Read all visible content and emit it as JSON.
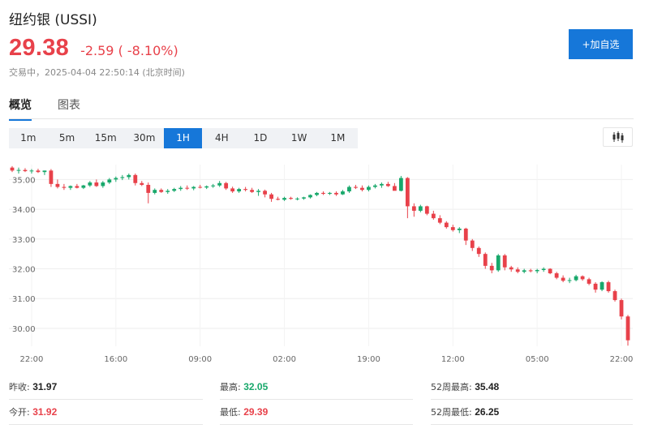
{
  "header": {
    "title": "纽约银 (USSI)",
    "price": "29.38",
    "change": "-2.59 ( -8.10%)",
    "status": "交易中，2025-04-04 22:50:14 (北京时间)",
    "add_button": "+加自选"
  },
  "tabs": [
    {
      "label": "概览",
      "active": true
    },
    {
      "label": "图表",
      "active": false
    }
  ],
  "intervals": [
    {
      "label": "1m",
      "active": false
    },
    {
      "label": "5m",
      "active": false
    },
    {
      "label": "15m",
      "active": false
    },
    {
      "label": "30m",
      "active": false
    },
    {
      "label": "1H",
      "active": true
    },
    {
      "label": "4H",
      "active": false
    },
    {
      "label": "1D",
      "active": false
    },
    {
      "label": "1W",
      "active": false
    },
    {
      "label": "1M",
      "active": false
    }
  ],
  "chart_type_icon": "candlestick-icon",
  "colors": {
    "up": "#18a86b",
    "down": "#e8414a",
    "accent": "#1677d9"
  },
  "chart_data": {
    "type": "candlestick",
    "y_ticks": [
      "35.00",
      "34.00",
      "33.00",
      "32.00",
      "31.00",
      "30.00"
    ],
    "y_tick_values": [
      35,
      34,
      33,
      32,
      31,
      30
    ],
    "ylim": [
      29.4,
      35.5
    ],
    "x_ticks": [
      "22:00",
      "16:00",
      "09:00",
      "02:00",
      "19:00",
      "12:00",
      "05:00",
      "22:00"
    ],
    "x_tick_index": [
      3,
      16,
      29,
      42,
      55,
      68,
      81,
      94
    ],
    "grid": true,
    "candles": [
      [
        35.4,
        35.45,
        35.25,
        35.3
      ],
      [
        35.3,
        35.4,
        35.2,
        35.32
      ],
      [
        35.32,
        35.38,
        35.25,
        35.28
      ],
      [
        35.28,
        35.35,
        35.2,
        35.3
      ],
      [
        35.3,
        35.36,
        35.22,
        35.25
      ],
      [
        35.25,
        35.3,
        35.15,
        35.3
      ],
      [
        35.3,
        35.35,
        34.75,
        34.85
      ],
      [
        34.85,
        35.0,
        34.7,
        34.75
      ],
      [
        34.75,
        34.85,
        34.65,
        34.72
      ],
      [
        34.72,
        34.8,
        34.65,
        34.78
      ],
      [
        34.78,
        34.85,
        34.7,
        34.72
      ],
      [
        34.72,
        34.82,
        34.68,
        34.8
      ],
      [
        34.8,
        34.95,
        34.75,
        34.9
      ],
      [
        34.9,
        35.0,
        34.75,
        34.78
      ],
      [
        34.78,
        34.95,
        34.72,
        34.9
      ],
      [
        34.9,
        35.05,
        34.85,
        35.0
      ],
      [
        35.0,
        35.1,
        34.92,
        35.05
      ],
      [
        35.05,
        35.15,
        34.98,
        35.08
      ],
      [
        35.08,
        35.2,
        35.0,
        35.15
      ],
      [
        35.15,
        35.2,
        34.8,
        34.88
      ],
      [
        34.88,
        34.95,
        34.78,
        34.82
      ],
      [
        34.82,
        34.9,
        34.2,
        34.55
      ],
      [
        34.55,
        34.7,
        34.5,
        34.65
      ],
      [
        34.65,
        34.7,
        34.55,
        34.58
      ],
      [
        34.58,
        34.68,
        34.52,
        34.62
      ],
      [
        34.62,
        34.72,
        34.58,
        34.68
      ],
      [
        34.68,
        34.78,
        34.62,
        34.72
      ],
      [
        34.72,
        34.8,
        34.65,
        34.7
      ],
      [
        34.7,
        34.78,
        34.64,
        34.75
      ],
      [
        34.75,
        34.82,
        34.7,
        34.73
      ],
      [
        34.73,
        34.8,
        34.68,
        34.77
      ],
      [
        34.77,
        34.85,
        34.72,
        34.8
      ],
      [
        34.8,
        34.95,
        34.75,
        34.88
      ],
      [
        34.88,
        34.92,
        34.65,
        34.7
      ],
      [
        34.7,
        34.76,
        34.55,
        34.6
      ],
      [
        34.6,
        34.72,
        34.55,
        34.68
      ],
      [
        34.68,
        34.75,
        34.6,
        34.65
      ],
      [
        34.65,
        34.72,
        34.55,
        34.58
      ],
      [
        34.58,
        34.68,
        34.45,
        34.62
      ],
      [
        34.62,
        34.66,
        34.4,
        34.5
      ],
      [
        34.5,
        34.55,
        34.25,
        34.35
      ],
      [
        34.35,
        34.42,
        34.3,
        34.32
      ],
      [
        34.32,
        34.42,
        34.28,
        34.38
      ],
      [
        34.38,
        34.42,
        34.32,
        34.35
      ],
      [
        34.35,
        34.4,
        34.3,
        34.36
      ],
      [
        34.36,
        34.42,
        34.32,
        34.4
      ],
      [
        34.4,
        34.5,
        34.36,
        34.48
      ],
      [
        34.48,
        34.58,
        34.44,
        34.55
      ],
      [
        34.55,
        34.6,
        34.48,
        34.52
      ],
      [
        34.52,
        34.58,
        34.48,
        34.55
      ],
      [
        34.55,
        34.6,
        34.45,
        34.5
      ],
      [
        34.5,
        34.65,
        34.48,
        34.6
      ],
      [
        34.6,
        34.8,
        34.55,
        34.75
      ],
      [
        34.75,
        34.82,
        34.68,
        34.72
      ],
      [
        34.72,
        34.8,
        34.6,
        34.65
      ],
      [
        34.65,
        34.8,
        34.6,
        34.75
      ],
      [
        34.75,
        34.85,
        34.7,
        34.8
      ],
      [
        34.8,
        34.9,
        34.72,
        34.85
      ],
      [
        34.85,
        34.92,
        34.75,
        34.78
      ],
      [
        34.78,
        34.88,
        34.7,
        34.62
      ],
      [
        34.62,
        35.12,
        34.6,
        35.05
      ],
      [
        35.05,
        35.08,
        33.7,
        34.1
      ],
      [
        34.1,
        34.2,
        33.75,
        33.95
      ],
      [
        33.95,
        34.15,
        33.9,
        34.1
      ],
      [
        34.1,
        34.12,
        33.8,
        33.85
      ],
      [
        33.85,
        33.95,
        33.65,
        33.7
      ],
      [
        33.7,
        33.8,
        33.5,
        33.55
      ],
      [
        33.55,
        33.6,
        33.35,
        33.4
      ],
      [
        33.4,
        33.48,
        33.25,
        33.3
      ],
      [
        33.3,
        33.4,
        33.2,
        33.35
      ],
      [
        33.35,
        33.38,
        32.8,
        32.95
      ],
      [
        32.95,
        33.0,
        32.6,
        32.7
      ],
      [
        32.7,
        32.75,
        32.4,
        32.5
      ],
      [
        32.5,
        32.55,
        32.0,
        32.1
      ],
      [
        32.1,
        32.2,
        31.85,
        31.95
      ],
      [
        31.95,
        32.5,
        31.9,
        32.45
      ],
      [
        32.45,
        32.5,
        31.95,
        32.05
      ],
      [
        32.05,
        32.1,
        31.9,
        31.98
      ],
      [
        31.98,
        32.05,
        31.85,
        31.9
      ],
      [
        31.9,
        32.0,
        31.85,
        31.95
      ],
      [
        31.95,
        32.0,
        31.88,
        31.92
      ],
      [
        31.92,
        32.0,
        31.85,
        31.96
      ],
      [
        31.96,
        32.05,
        31.9,
        32.0
      ],
      [
        32.0,
        32.02,
        31.82,
        31.85
      ],
      [
        31.85,
        31.9,
        31.65,
        31.7
      ],
      [
        31.7,
        31.78,
        31.55,
        31.6
      ],
      [
        31.6,
        31.7,
        31.52,
        31.62
      ],
      [
        31.62,
        31.8,
        31.58,
        31.75
      ],
      [
        31.75,
        31.78,
        31.6,
        31.65
      ],
      [
        31.65,
        31.7,
        31.45,
        31.5
      ],
      [
        31.5,
        31.55,
        31.2,
        31.3
      ],
      [
        31.3,
        31.58,
        31.25,
        31.55
      ],
      [
        31.55,
        31.6,
        31.2,
        31.25
      ],
      [
        31.25,
        31.3,
        30.9,
        30.95
      ],
      [
        30.95,
        31.0,
        30.3,
        30.4
      ],
      [
        30.4,
        30.45,
        29.42,
        29.6
      ]
    ]
  },
  "stats": {
    "prev_close": {
      "label": "昨收:",
      "value": "31.97"
    },
    "high": {
      "label": "最高:",
      "value": "32.05"
    },
    "high52": {
      "label": "52周最高:",
      "value": "35.48"
    },
    "open": {
      "label": "今开:",
      "value": "31.92"
    },
    "low": {
      "label": "最低:",
      "value": "29.39"
    },
    "low52": {
      "label": "52周最低:",
      "value": "26.25"
    }
  }
}
